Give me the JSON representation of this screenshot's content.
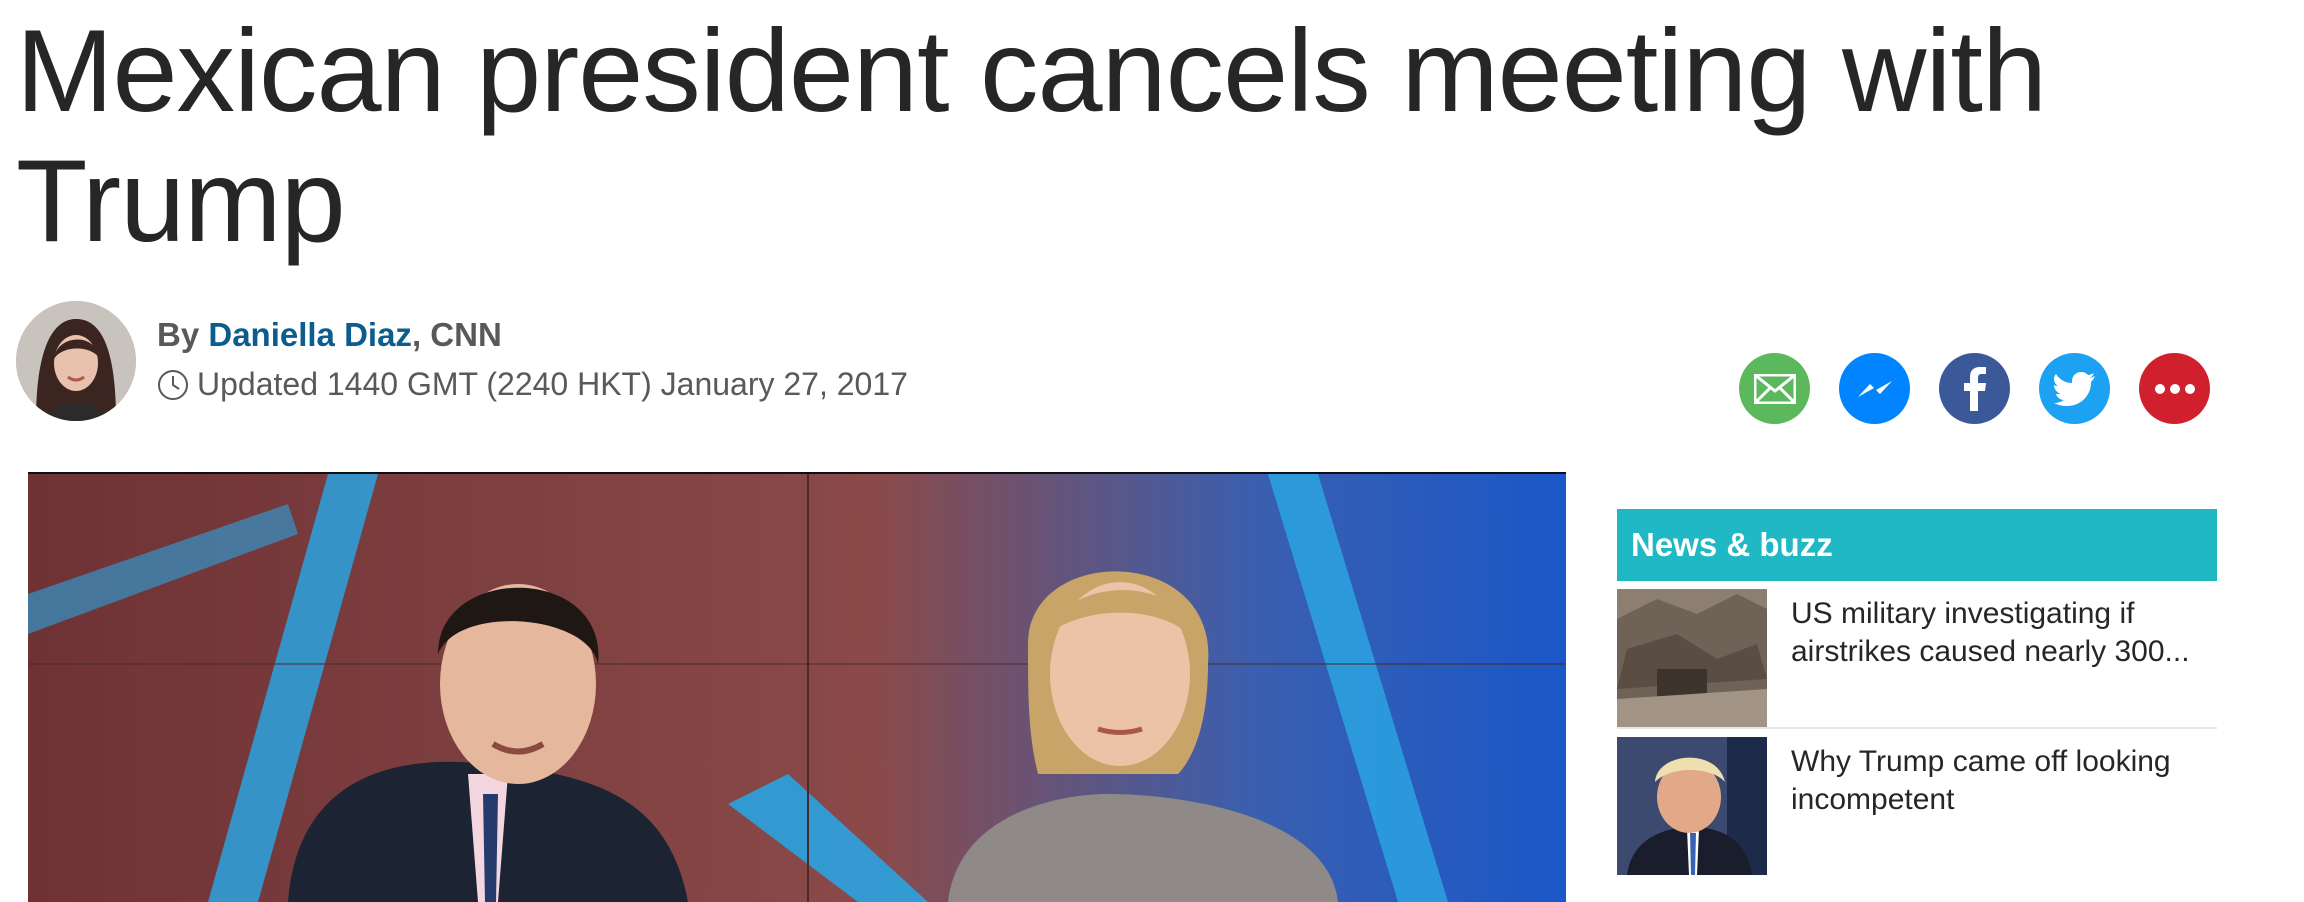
{
  "article": {
    "headline": "Mexican president cancels meeting with Trump",
    "byline": {
      "prefix": "By",
      "author": "Daniella Diaz",
      "separator": ", ",
      "org": "CNN"
    },
    "updated": "Updated 1440 GMT (2240 HKT) January 27, 2017"
  },
  "share": [
    {
      "name": "email-share-button",
      "icon": "email-icon",
      "color": "#5cb85c"
    },
    {
      "name": "messenger-share-button",
      "icon": "messenger-icon",
      "color": "#0084ff"
    },
    {
      "name": "facebook-share-button",
      "icon": "facebook-icon",
      "color": "#3b5998"
    },
    {
      "name": "twitter-share-button",
      "icon": "twitter-icon",
      "color": "#1da1f2"
    },
    {
      "name": "more-share-button",
      "icon": "more-icon",
      "color": "#d0202e"
    }
  ],
  "sidebar": {
    "title": "News & buzz",
    "items": [
      {
        "text": "US military investigating if airstrikes caused nearly 300..."
      },
      {
        "text": "Why Trump came off looking incompetent"
      }
    ]
  },
  "colors": {
    "accent": "#1fb8c4",
    "link": "#0c5c8e"
  }
}
